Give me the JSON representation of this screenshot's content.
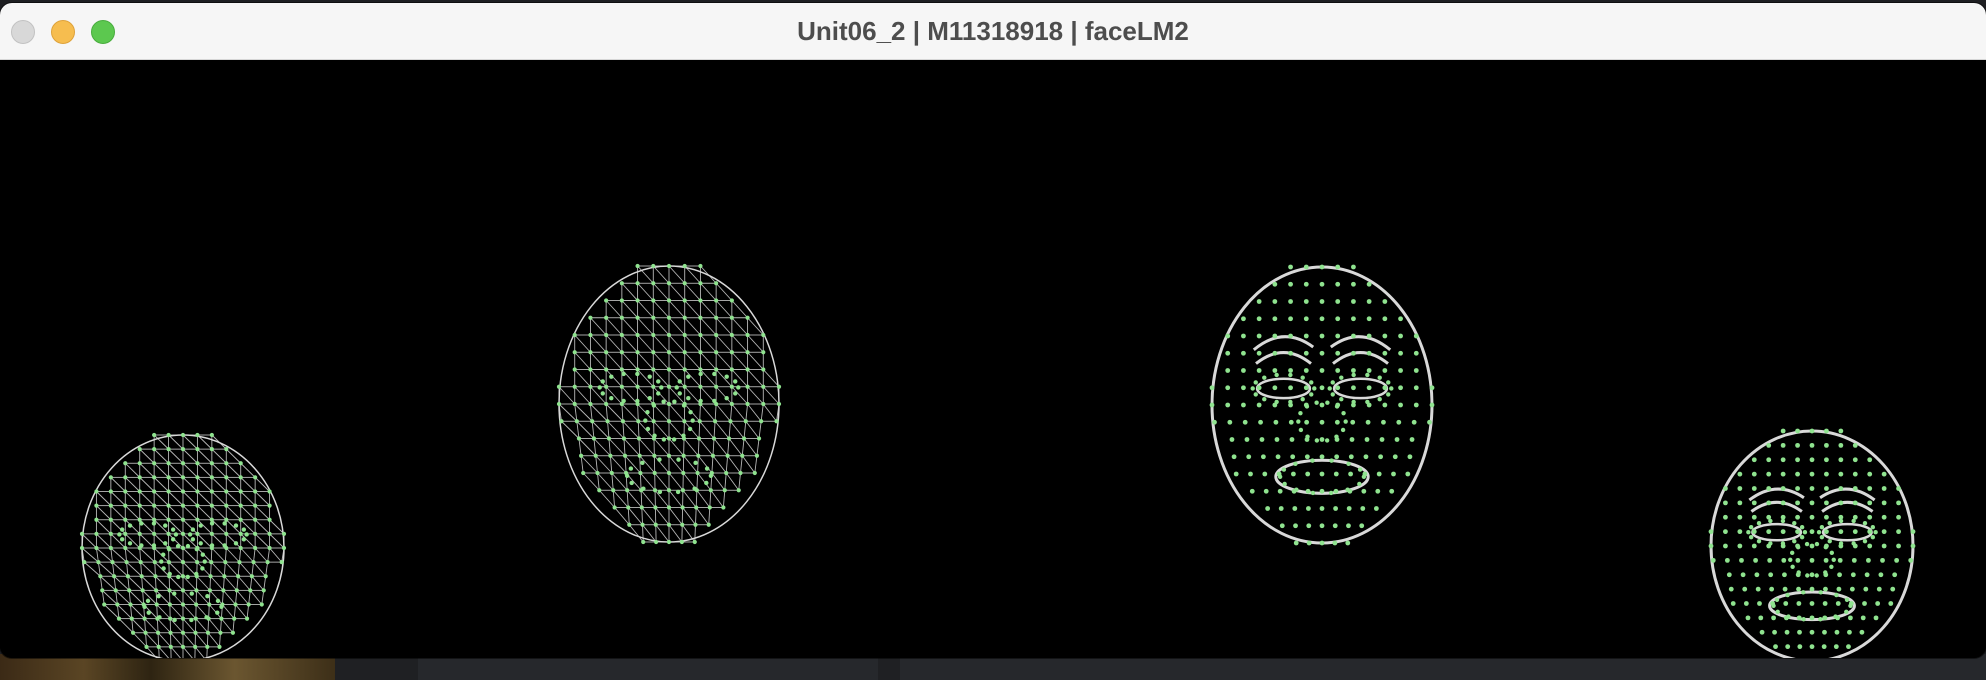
{
  "window": {
    "title": "Unit06_2 | M11318918 | faceLM2"
  },
  "controls": {
    "close": "close-button",
    "minimize": "minimize-button",
    "maximize": "maximize-button"
  },
  "canvas": {
    "background": "#000000",
    "mesh_color": "#d9d9d9",
    "landmark_color": "#8fe38f",
    "faces": [
      {
        "name": "face-1",
        "style": "tessellation"
      },
      {
        "name": "face-2",
        "style": "tessellation"
      },
      {
        "name": "face-3",
        "style": "contours"
      },
      {
        "name": "face-4",
        "style": "contours"
      }
    ]
  }
}
